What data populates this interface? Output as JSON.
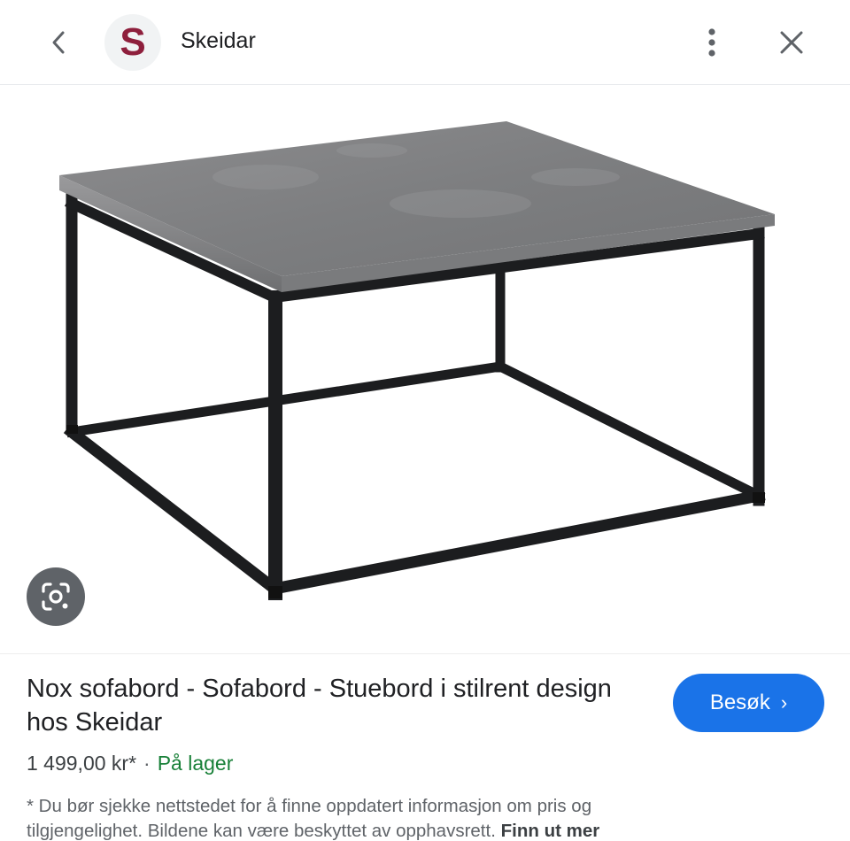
{
  "header": {
    "logo_letter": "S",
    "site_name": "Skeidar",
    "icons": {
      "back": "chevron-left-icon",
      "more": "more-vert-icon",
      "close": "close-icon"
    },
    "brand_color": "#8e1f3c"
  },
  "image": {
    "subject": "Nox sofabord",
    "lens_icon": "google-lens-icon"
  },
  "result": {
    "title": "Nox sofabord - Sofabord - Stuebord i stilrent design hos Skeidar",
    "visit_label": "Besøk",
    "visit_chevron": "›",
    "price": "1 499,00 kr*",
    "separator": "·",
    "stock": "På lager",
    "stock_color": "#188038",
    "accent_color": "#1a73e8",
    "disclaimer": "* Du bør sjekke nettstedet for å finne oppdatert informasjon om pris og tilgjengelighet. Bildene kan være beskyttet av opphavsrett.",
    "learn_more": "Finn ut mer"
  }
}
